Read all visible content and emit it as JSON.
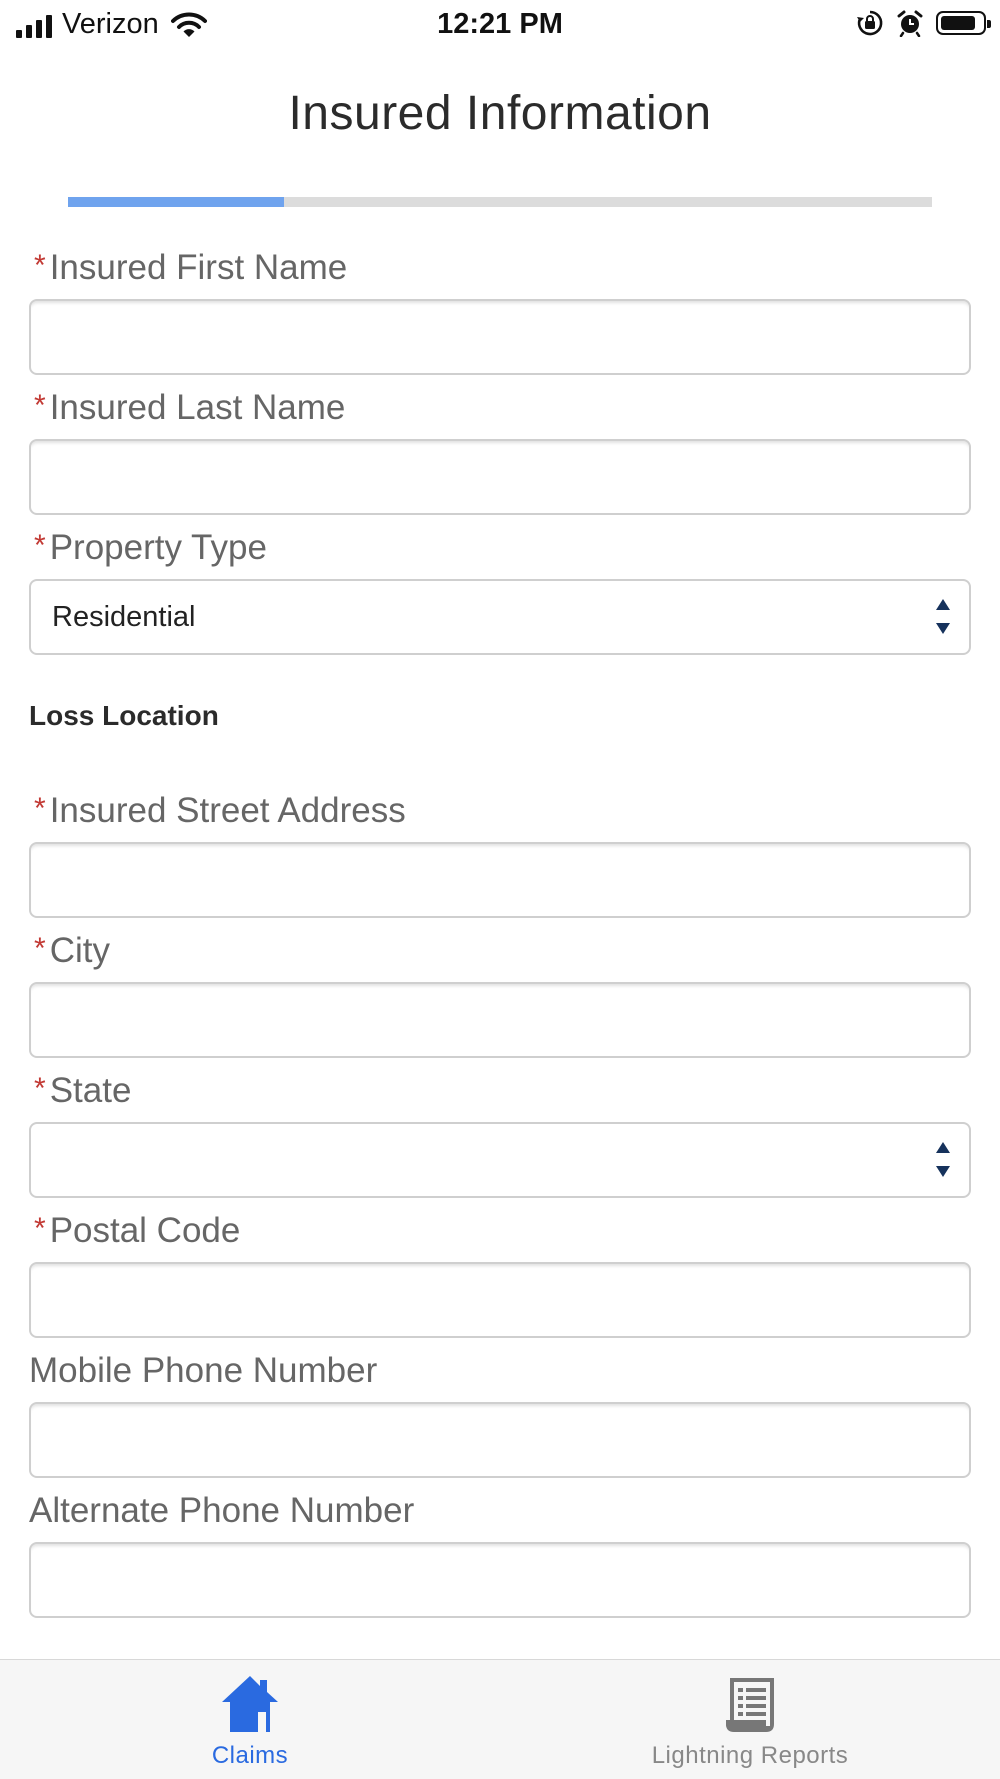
{
  "status_bar": {
    "carrier": "Verizon",
    "time": "12:21 PM"
  },
  "header": {
    "title": "Insured Information",
    "progress_fraction": 0.25
  },
  "form": {
    "first_name": {
      "label": "Insured First Name",
      "required_mark": "*",
      "value": ""
    },
    "last_name": {
      "label": "Insured Last Name",
      "required_mark": "*",
      "value": ""
    },
    "property_type": {
      "label": "Property Type",
      "required_mark": "*",
      "value": "Residential"
    },
    "loss_location_heading": "Loss Location",
    "street_address": {
      "label": "Insured Street Address",
      "required_mark": "*",
      "value": ""
    },
    "city": {
      "label": "City",
      "required_mark": "*",
      "value": ""
    },
    "state": {
      "label": "State",
      "required_mark": "*",
      "value": ""
    },
    "postal_code": {
      "label": "Postal Code",
      "required_mark": "*",
      "value": ""
    },
    "mobile_phone": {
      "label": "Mobile Phone Number",
      "value": ""
    },
    "alternate_phone": {
      "label": "Alternate Phone Number",
      "value": ""
    }
  },
  "tab_bar": {
    "claims": {
      "label": "Claims",
      "icon": "home-icon",
      "active": true
    },
    "reports": {
      "label": "Lightning Reports",
      "icon": "report-icon",
      "active": false
    }
  },
  "colors": {
    "accent": "#2a6ae0",
    "progress": "#6fa3ee",
    "required": "#c23934",
    "select_arrows": "#16325c"
  }
}
